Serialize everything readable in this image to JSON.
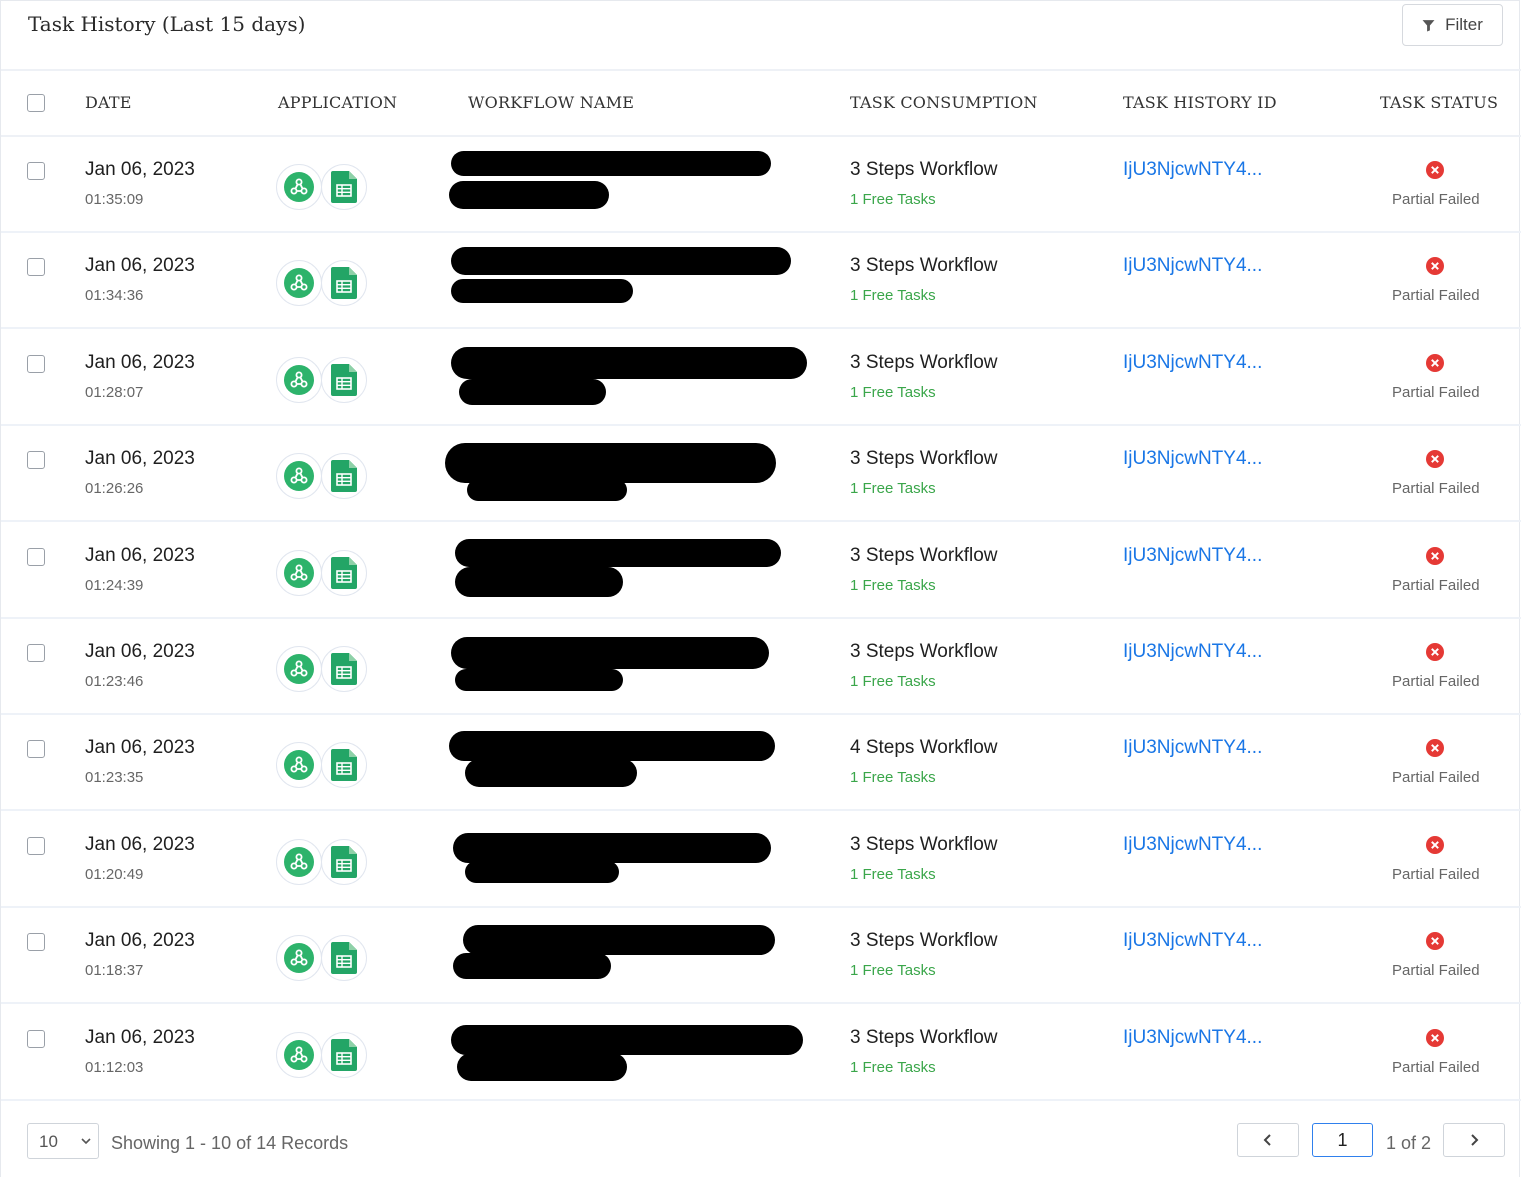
{
  "header": {
    "title": "Task History (Last 15 days)",
    "filter_label": "Filter"
  },
  "columns": {
    "date": "DATE",
    "application": "APPLICATION",
    "workflow_name": "WORKFLOW NAME",
    "task_consumption": "TASK CONSUMPTION",
    "task_history_id": "TASK HISTORY ID",
    "task_status": "TASK STATUS"
  },
  "icons": {
    "filter": "filter-icon",
    "app1": "webhook-icon",
    "app2": "google-sheets-icon",
    "status": "error-circle-icon",
    "prev": "chevron-left-icon",
    "next": "chevron-right-icon",
    "select": "chevron-down-icon"
  },
  "colors": {
    "link": "#1976e6",
    "free_tasks": "#3aa64a",
    "error": "#e53935",
    "webhook": "#2db36b",
    "sheets": "#23a566"
  },
  "rows": [
    {
      "date": "Jan 06, 2023",
      "time": "01:35:09",
      "consumption": "3 Steps Workflow",
      "free": "1 Free Tasks",
      "history_id": "IjU3NjcwNTY4...",
      "status": "Partial Failed"
    },
    {
      "date": "Jan 06, 2023",
      "time": "01:34:36",
      "consumption": "3 Steps Workflow",
      "free": "1 Free Tasks",
      "history_id": "IjU3NjcwNTY4...",
      "status": "Partial Failed"
    },
    {
      "date": "Jan 06, 2023",
      "time": "01:28:07",
      "consumption": "3 Steps Workflow",
      "free": "1 Free Tasks",
      "history_id": "IjU3NjcwNTY4...",
      "status": "Partial Failed"
    },
    {
      "date": "Jan 06, 2023",
      "time": "01:26:26",
      "consumption": "3 Steps Workflow",
      "free": "1 Free Tasks",
      "history_id": "IjU3NjcwNTY4...",
      "status": "Partial Failed"
    },
    {
      "date": "Jan 06, 2023",
      "time": "01:24:39",
      "consumption": "3 Steps Workflow",
      "free": "1 Free Tasks",
      "history_id": "IjU3NjcwNTY4...",
      "status": "Partial Failed"
    },
    {
      "date": "Jan 06, 2023",
      "time": "01:23:46",
      "consumption": "3 Steps Workflow",
      "free": "1 Free Tasks",
      "history_id": "IjU3NjcwNTY4...",
      "status": "Partial Failed"
    },
    {
      "date": "Jan 06, 2023",
      "time": "01:23:35",
      "consumption": "4 Steps Workflow",
      "free": "1 Free Tasks",
      "history_id": "IjU3NjcwNTY4...",
      "status": "Partial Failed"
    },
    {
      "date": "Jan 06, 2023",
      "time": "01:20:49",
      "consumption": "3 Steps Workflow",
      "free": "1 Free Tasks",
      "history_id": "IjU3NjcwNTY4...",
      "status": "Partial Failed"
    },
    {
      "date": "Jan 06, 2023",
      "time": "01:18:37",
      "consumption": "3 Steps Workflow",
      "free": "1 Free Tasks",
      "history_id": "IjU3NjcwNTY4...",
      "status": "Partial Failed"
    },
    {
      "date": "Jan 06, 2023",
      "time": "01:12:03",
      "consumption": "3 Steps Workflow",
      "free": "1 Free Tasks",
      "history_id": "IjU3NjcwNTY4...",
      "status": "Partial Failed"
    }
  ],
  "footer": {
    "page_size": "10",
    "showing": "Showing 1 - 10 of 14 Records",
    "current_page": "1",
    "page_of": "1 of 2"
  }
}
